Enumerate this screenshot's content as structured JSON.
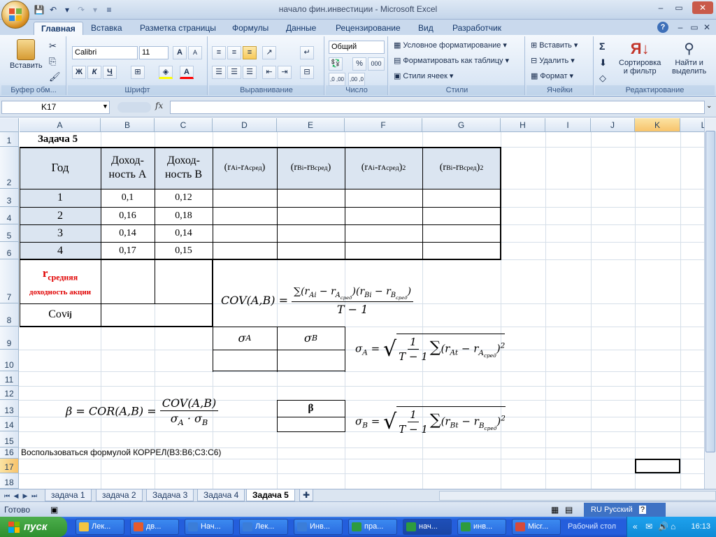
{
  "window": {
    "title": "начало фин.инвестиции - Microsoft Excel",
    "controls": {
      "minimize": "–",
      "maximize": "▭",
      "close": "✕"
    }
  },
  "ribbon_tabs": [
    {
      "label": "Главная",
      "active": true
    },
    {
      "label": "Вставка"
    },
    {
      "label": "Разметка страницы"
    },
    {
      "label": "Формулы"
    },
    {
      "label": "Данные"
    },
    {
      "label": "Рецензирование"
    },
    {
      "label": "Вид"
    },
    {
      "label": "Разработчик"
    }
  ],
  "ribbon": {
    "clipboard": {
      "label": "Буфер обм...",
      "paste": "Вставить"
    },
    "font": {
      "label": "Шрифт",
      "name": "Calibri",
      "size": "11",
      "bold": "Ж",
      "italic": "К",
      "underline": "Ч",
      "grow": "A",
      "shrink": "A",
      "color": "A"
    },
    "alignment": {
      "label": "Выравнивание"
    },
    "number": {
      "label": "Число",
      "format": "Общий",
      "percent": "%",
      "thousands": "000",
      "inc_dec": ",0 ,00",
      "dec_dec": ",00 ,0"
    },
    "styles": {
      "label": "Стили",
      "conditional": "Условное форматирование",
      "as_table": "Форматировать как таблицу",
      "cell_styles": "Стили ячеек"
    },
    "cells": {
      "label": "Ячейки",
      "insert": "Вставить",
      "delete": "Удалить",
      "format": "Формат"
    },
    "editing": {
      "label": "Редактирование",
      "sum": "Σ",
      "sort": "Сортировка и фильтр",
      "find": "Найти и выделить",
      "sort_l1": "Сортировка",
      "sort_l2": "и фильтр",
      "find_l1": "Найти и",
      "find_l2": "выделить"
    }
  },
  "formula_bar": {
    "name_box": "K17",
    "fx": "fx",
    "value": ""
  },
  "columns": [
    "A",
    "B",
    "C",
    "D",
    "E",
    "F",
    "G",
    "H",
    "I",
    "J",
    "K",
    "L"
  ],
  "rows": [
    "1",
    "2",
    "3",
    "4",
    "5",
    "6",
    "7",
    "8",
    "9",
    "10",
    "11",
    "12",
    "13",
    "14",
    "15",
    "16",
    "17",
    "18"
  ],
  "sheet": {
    "task_title": "Задача 5",
    "header_year": "Год",
    "header_a_l1": "Доход-",
    "header_a_l2": "ность А",
    "header_b_l1": "Доход-",
    "header_b_l2": "ность В",
    "table_rows": [
      {
        "year": "1",
        "a": "0,1",
        "b": "0,12"
      },
      {
        "year": "2",
        "a": "0,16",
        "b": "0,18"
      },
      {
        "year": "3",
        "a": "0,14",
        "b": "0,14"
      },
      {
        "year": "4",
        "a": "0,17",
        "b": "0,15"
      }
    ],
    "avg_label_r": "r",
    "avg_label_sub": "средняя",
    "avg_label_2": "доходность акции",
    "cov_label": "Cov",
    "cov_sub": "ij",
    "beta_header": "β",
    "note": "Воспользоваться формулой КОРРЕЛ(B3:B6;C3:C6)"
  },
  "sheet_tabs": [
    {
      "label": "задача 1"
    },
    {
      "label": "задача 2"
    },
    {
      "label": "Задача 3"
    },
    {
      "label": "Задача 4"
    },
    {
      "label": "Задача 5",
      "active": true
    }
  ],
  "status": {
    "ready": "Готово",
    "language": "RU Русский"
  },
  "taskbar": {
    "start": "пуск",
    "buttons": [
      "Лек...",
      "дв...",
      "Нач...",
      "Лек...",
      "Инв...",
      "пра...",
      "нач...",
      "инв...",
      "Micr..."
    ],
    "desktop": "Рабочий стол",
    "clock": "16:13"
  }
}
